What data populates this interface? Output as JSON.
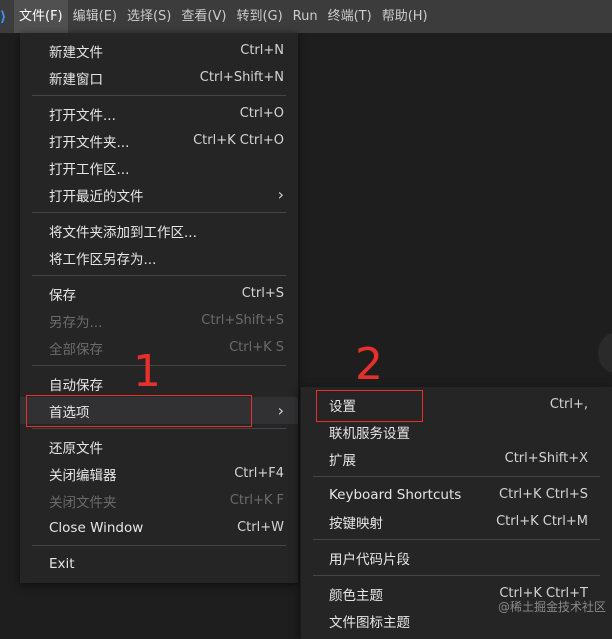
{
  "menubar": {
    "logo_icon": "vscode-logo-icon",
    "items": [
      "文件(F)",
      "编辑(E)",
      "选择(S)",
      "查看(V)",
      "转到(G)",
      "Run",
      "终端(T)",
      "帮助(H)"
    ]
  },
  "file_menu": [
    {
      "label": "新建文件",
      "shortcut": "Ctrl+N",
      "disabled": false
    },
    {
      "label": "新建窗口",
      "shortcut": "Ctrl+Shift+N",
      "disabled": false
    },
    {
      "sep": true
    },
    {
      "label": "打开文件...",
      "shortcut": "Ctrl+O",
      "disabled": false
    },
    {
      "label": "打开文件夹...",
      "shortcut": "Ctrl+K Ctrl+O",
      "disabled": false
    },
    {
      "label": "打开工作区...",
      "shortcut": "",
      "disabled": false
    },
    {
      "label": "打开最近的文件",
      "shortcut": "",
      "submenu": true,
      "disabled": false
    },
    {
      "sep": true
    },
    {
      "label": "将文件夹添加到工作区...",
      "shortcut": "",
      "disabled": false
    },
    {
      "label": "将工作区另存为...",
      "shortcut": "",
      "disabled": false
    },
    {
      "sep": true
    },
    {
      "label": "保存",
      "shortcut": "Ctrl+S",
      "disabled": false
    },
    {
      "label": "另存为...",
      "shortcut": "Ctrl+Shift+S",
      "disabled": true
    },
    {
      "label": "全部保存",
      "shortcut": "Ctrl+K S",
      "disabled": true
    },
    {
      "sep": true
    },
    {
      "label": "自动保存",
      "shortcut": "",
      "disabled": false
    },
    {
      "label": "首选项",
      "shortcut": "",
      "submenu": true,
      "selected": true,
      "disabled": false
    },
    {
      "sep": true
    },
    {
      "label": "还原文件",
      "shortcut": "",
      "disabled": false
    },
    {
      "label": "关闭编辑器",
      "shortcut": "Ctrl+F4",
      "disabled": false
    },
    {
      "label": "关闭文件夹",
      "shortcut": "Ctrl+K F",
      "disabled": true
    },
    {
      "label": "Close Window",
      "shortcut": "Ctrl+W",
      "disabled": false
    },
    {
      "sep": true
    },
    {
      "label": "Exit",
      "shortcut": "",
      "disabled": false
    }
  ],
  "preferences_menu": [
    {
      "label": "设置",
      "shortcut": "Ctrl+,"
    },
    {
      "label": "联机服务设置",
      "shortcut": ""
    },
    {
      "label": "扩展",
      "shortcut": "Ctrl+Shift+X"
    },
    {
      "sep": true
    },
    {
      "label": "Keyboard Shortcuts",
      "shortcut": "Ctrl+K Ctrl+S"
    },
    {
      "label": "按键映射",
      "shortcut": "Ctrl+K Ctrl+M"
    },
    {
      "sep": true
    },
    {
      "label": "用户代码片段",
      "shortcut": ""
    },
    {
      "sep": true
    },
    {
      "label": "颜色主题",
      "shortcut": "Ctrl+K Ctrl+T"
    },
    {
      "label": "文件图标主题",
      "shortcut": ""
    }
  ],
  "annotations": {
    "num1": "1",
    "num2": "2",
    "color": "#e8302a"
  },
  "watermark": "@稀土掘金技术社区"
}
